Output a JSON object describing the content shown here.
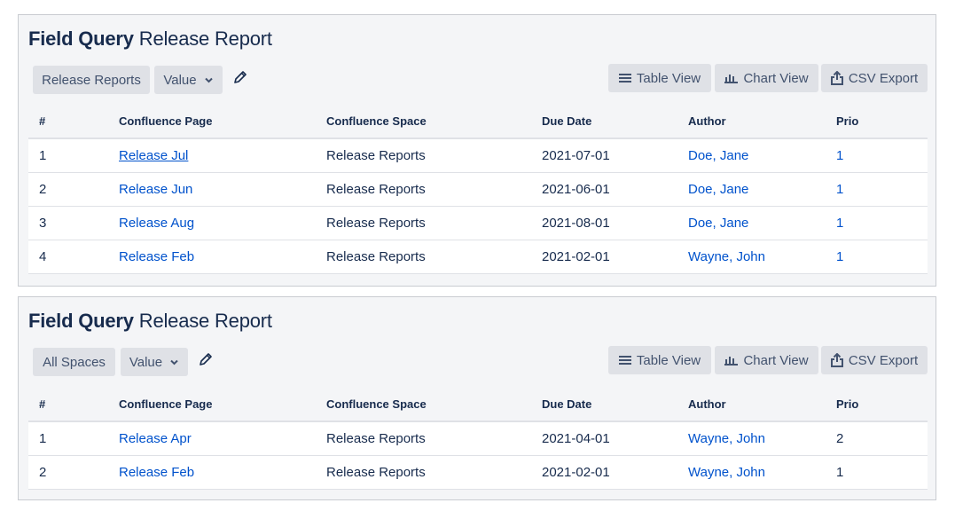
{
  "reports": [
    {
      "title_bold": "Field Query",
      "title_rest": "Release Report",
      "filter_label": "Release Reports",
      "value_label": "Value",
      "view_buttons": {
        "table": "Table View",
        "chart": "Chart View",
        "csv": "CSV Export"
      },
      "columns": [
        "#",
        "Confluence Page",
        "Confluence Space",
        "Due Date",
        "Author",
        "Prio"
      ],
      "rows": [
        {
          "num": "1",
          "page": "Release Jul",
          "space": "Release Reports",
          "date": "2021-07-01",
          "author": "Doe, Jane",
          "prio": "1"
        },
        {
          "num": "2",
          "page": "Release Jun",
          "space": "Release Reports",
          "date": "2021-06-01",
          "author": "Doe, Jane",
          "prio": "1"
        },
        {
          "num": "3",
          "page": "Release Aug",
          "space": "Release Reports",
          "date": "2021-08-01",
          "author": "Doe, Jane",
          "prio": "1"
        },
        {
          "num": "4",
          "page": "Release Feb",
          "space": "Release Reports",
          "date": "2021-02-01",
          "author": "Wayne, John",
          "prio": "1"
        }
      ]
    },
    {
      "title_bold": "Field Query",
      "title_rest": "Release Report",
      "filter_label": "All Spaces",
      "value_label": "Value",
      "view_buttons": {
        "table": "Table View",
        "chart": "Chart View",
        "csv": "CSV Export"
      },
      "columns": [
        "#",
        "Confluence Page",
        "Confluence Space",
        "Due Date",
        "Author",
        "Prio"
      ],
      "rows": [
        {
          "num": "1",
          "page": "Release Apr",
          "space": "Release Reports",
          "date": "2021-04-01",
          "author": "Wayne, John",
          "prio": "2"
        },
        {
          "num": "2",
          "page": "Release Feb",
          "space": "Release Reports",
          "date": "2021-02-01",
          "author": "Wayne, John",
          "prio": "1"
        }
      ]
    }
  ],
  "icons": {
    "table": "list-lines-icon",
    "chart": "bar-chart-icon",
    "csv": "export-share-icon",
    "edit": "pencil-icon",
    "dropdown": "chevron-down-icon"
  },
  "colors": {
    "link": "#0052cc",
    "text": "#172b4d",
    "button_bg": "#dfe1e6",
    "panel_bg": "#f4f5f7"
  }
}
